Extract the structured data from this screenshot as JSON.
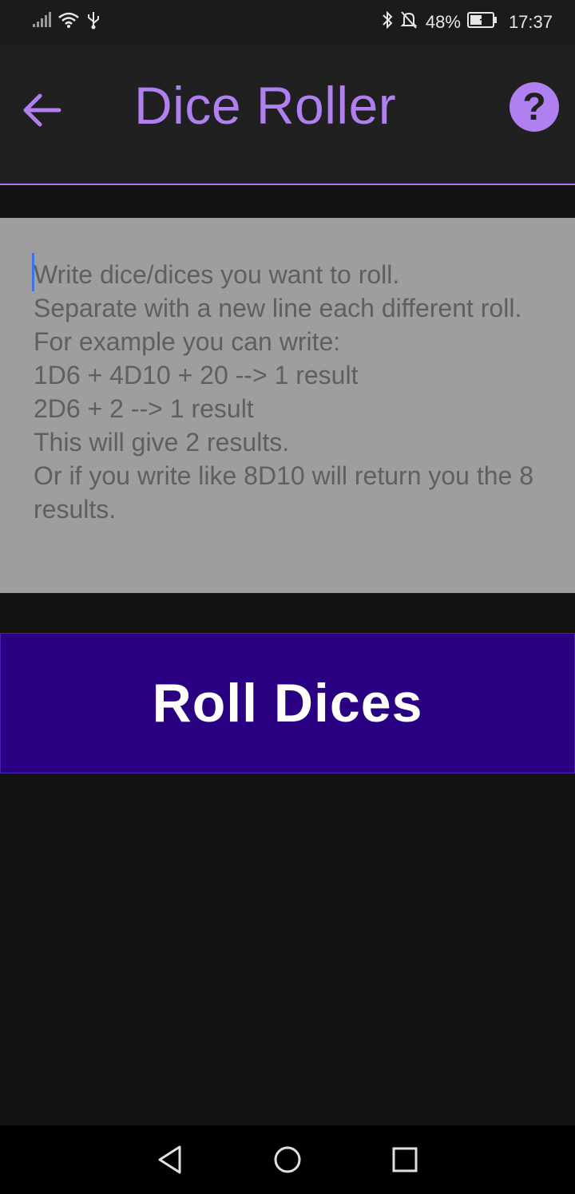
{
  "status_bar": {
    "battery": "48%",
    "time": "17:37"
  },
  "app_bar": {
    "title": "Dice Roller",
    "accent_color": "#b07ff0"
  },
  "input": {
    "placeholder": "Write dice/dices you want to roll.\nSeparate with a new line each different roll.\nFor example you can write:\n1D6 + 4D10 + 20 --> 1 result\n2D6 + 2 --> 1 result\nThis will give 2 results.\nOr if you write like 8D10 will return you the 8 results.",
    "value": ""
  },
  "roll_button": {
    "label": "Roll Dices",
    "color": "#2a0082"
  },
  "nav_bar": {
    "icons": [
      "back-triangle-icon",
      "home-circle-icon",
      "recents-square-icon"
    ]
  }
}
